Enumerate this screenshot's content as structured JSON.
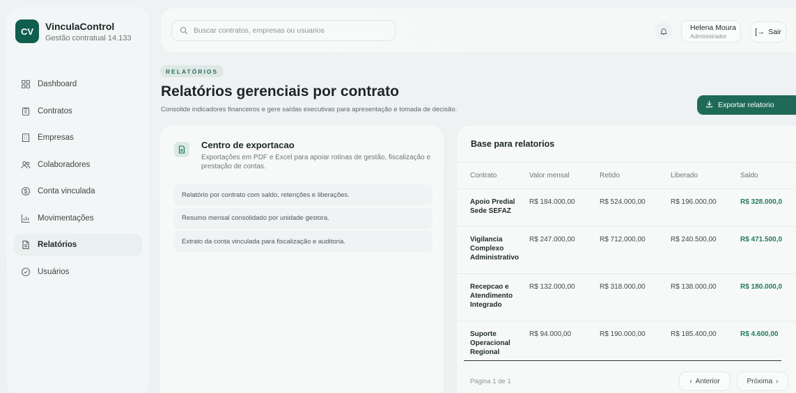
{
  "brand": {
    "logo_text": "CV",
    "name": "VinculaControl",
    "subtitle": "Gestão contratual 14.133"
  },
  "sidebar": {
    "items": [
      {
        "label": "Dashboard",
        "icon": "grid-icon"
      },
      {
        "label": "Contratos",
        "icon": "clipboard-icon"
      },
      {
        "label": "Empresas",
        "icon": "building-icon"
      },
      {
        "label": "Colaboradores",
        "icon": "users-icon"
      },
      {
        "label": "Conta vinculada",
        "icon": "coin-icon"
      },
      {
        "label": "Movimentações",
        "icon": "bar-chart-icon"
      },
      {
        "label": "Relatórios",
        "icon": "file-text-icon",
        "active": true
      },
      {
        "label": "Usuários",
        "icon": "shield-check-icon"
      }
    ]
  },
  "topbar": {
    "search_placeholder": "Buscar contratos, empresas ou usuarios",
    "user_name": "Helena Moura",
    "user_role": "Administrador",
    "logout_label": "Sair"
  },
  "header": {
    "eyebrow": "RELATÓRIOS",
    "title": "Relatórios gerenciais por contrato",
    "subtitle": "Consolide indicadores financeiros e gere saídas executivas para apresentação e tomada de decisão.",
    "export_label": "Exportar relatorio"
  },
  "export_center": {
    "title": "Centro de exportacao",
    "description": "Exportações em PDF e Excel para apoiar rotinas de gestão, fiscalização e prestação de contas.",
    "items": [
      "Relatório por contrato com saldo, retenções e liberações.",
      "Resumo mensal consolidado por unidade gestora.",
      "Extrato da conta vinculada para fiscalização e auditoria."
    ]
  },
  "table": {
    "title": "Base para relatorios",
    "columns": [
      "Contrato",
      "Valor mensal",
      "Retido",
      "Liberado",
      "Saldo"
    ],
    "rows": [
      {
        "contrato": "Apoio Predial Sede SEFAZ",
        "valor": "R$ 184.000,00",
        "retido": "R$ 524.000,00",
        "liberado": "R$ 196.000,00",
        "saldo": "R$ 328.000,0"
      },
      {
        "contrato": "Vigilancia Complexo Administrativo",
        "valor": "R$ 247.000,00",
        "retido": "R$ 712.000,00",
        "liberado": "R$ 240.500,00",
        "saldo": "R$ 471.500,0"
      },
      {
        "contrato": "Recepcao e Atendimento Integrado",
        "valor": "R$ 132.000,00",
        "retido": "R$ 318.000,00",
        "liberado": "R$ 138.000,00",
        "saldo": "R$ 180.000,0"
      },
      {
        "contrato": "Suporte Operacional Regional",
        "valor": "R$ 94.000,00",
        "retido": "R$ 190.000,00",
        "liberado": "R$ 185.400,00",
        "saldo": "R$ 4.600,00"
      }
    ],
    "page_info": "Página 1 de 1",
    "prev_label": "Anterior",
    "next_label": "Próxima"
  },
  "colors": {
    "brand": "#0f5e4e",
    "accent": "#1f6a56",
    "positive": "#1f7a5e"
  }
}
